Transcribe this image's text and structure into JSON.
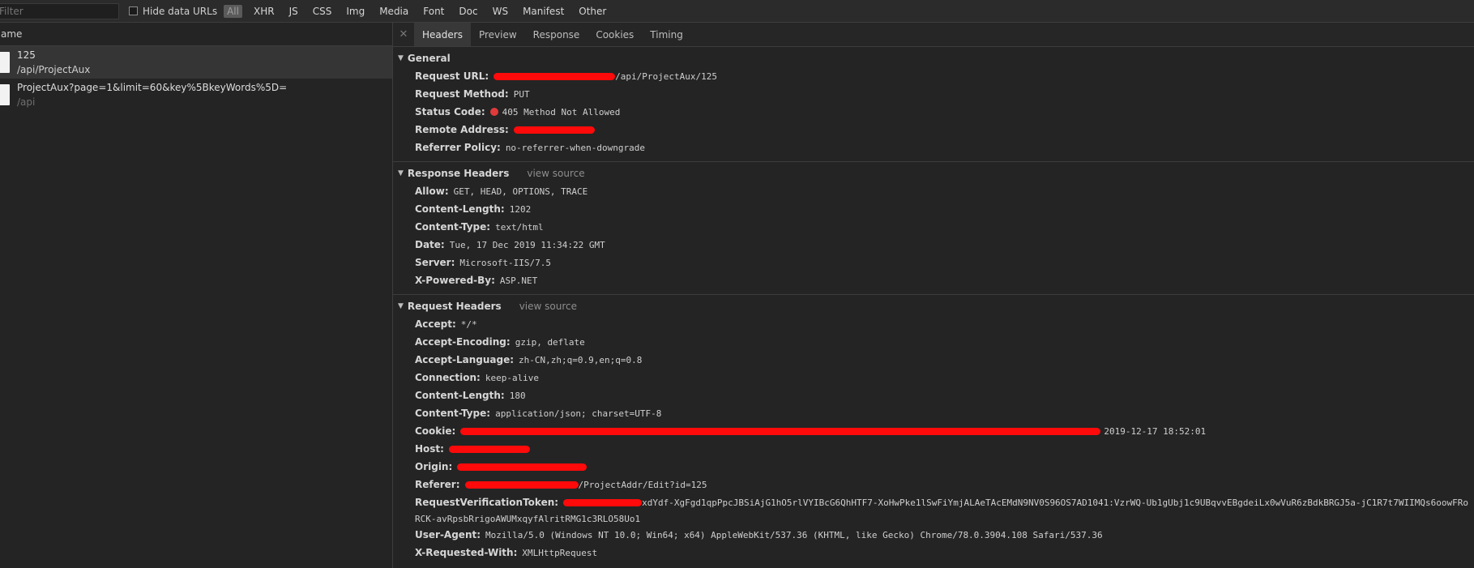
{
  "toolbar": {
    "filter_placeholder": "Filter",
    "hide_data_urls": "Hide data URLs",
    "types": [
      "All",
      "XHR",
      "JS",
      "CSS",
      "Img",
      "Media",
      "Font",
      "Doc",
      "WS",
      "Manifest",
      "Other"
    ],
    "active_type": "All"
  },
  "requests_pane": {
    "header": "Name",
    "requests": [
      {
        "name": "125",
        "path": "/api/ProjectAux",
        "selected": true
      },
      {
        "name": "ProjectAux?page=1&limit=60&key%5BkeyWords%5D=",
        "path": "/api",
        "selected": false
      }
    ]
  },
  "details": {
    "tabs": [
      "Headers",
      "Preview",
      "Response",
      "Cookies",
      "Timing"
    ],
    "active_tab": "Headers",
    "general": {
      "title": "General",
      "rows": {
        "request_url": {
          "key": "Request URL:",
          "value": "/api/ProjectAux/125"
        },
        "request_method": {
          "key": "Request Method:",
          "value": "PUT"
        },
        "status_code": {
          "key": "Status Code:",
          "value": "405 Method Not Allowed"
        },
        "remote_address": {
          "key": "Remote Address:",
          "value": ""
        },
        "referrer_policy": {
          "key": "Referrer Policy:",
          "value": "no-referrer-when-downgrade"
        }
      }
    },
    "response_headers": {
      "title": "Response Headers",
      "view_source": "view source",
      "rows": [
        {
          "key": "Allow:",
          "value": "GET, HEAD, OPTIONS, TRACE"
        },
        {
          "key": "Content-Length:",
          "value": "1202"
        },
        {
          "key": "Content-Type:",
          "value": "text/html"
        },
        {
          "key": "Date:",
          "value": "Tue, 17 Dec 2019 11:34:22 GMT"
        },
        {
          "key": "Server:",
          "value": "Microsoft-IIS/7.5"
        },
        {
          "key": "X-Powered-By:",
          "value": "ASP.NET"
        }
      ]
    },
    "request_headers": {
      "title": "Request Headers",
      "view_source": "view source",
      "rows": [
        {
          "key": "Accept:",
          "value": "*/*"
        },
        {
          "key": "Accept-Encoding:",
          "value": "gzip, deflate"
        },
        {
          "key": "Accept-Language:",
          "value": "zh-CN,zh;q=0.9,en;q=0.8"
        },
        {
          "key": "Connection:",
          "value": "keep-alive"
        },
        {
          "key": "Content-Length:",
          "value": "180"
        },
        {
          "key": "Content-Type:",
          "value": "application/json; charset=UTF-8"
        }
      ],
      "cookie": {
        "key": "Cookie:",
        "value_tail": "2019-12-17 18:52:01"
      },
      "host": {
        "key": "Host:"
      },
      "origin": {
        "key": "Origin:"
      },
      "referer": {
        "key": "Referer:",
        "value_tail": "/ProjectAddr/Edit?id=125"
      },
      "rvt": {
        "key": "RequestVerificationToken:",
        "value_line1": "xdYdf-XgFgd1qpPpcJBSiAjG1hO5rlVYIBcG6QhHTF7-XoHwPke1lSwFiYmjALAeTAcEMdN9NV0S96OS7AD1041:VzrWQ-Ub1gUbj1c9UBqvvEBgdeiLx0wVuR6zBdkBRGJ5a-jC1R7t7WIIMQs6oowFRo",
        "value_line2": "RCK-avRpsbRrigoAWUMxqyfAlritRMG1c3RLO58Uo1"
      },
      "user_agent": {
        "key": "User-Agent:",
        "value": "Mozilla/5.0 (Windows NT 10.0; Win64; x64) AppleWebKit/537.36 (KHTML, like Gecko) Chrome/78.0.3904.108 Safari/537.36"
      },
      "x_requested_with": {
        "key": "X-Requested-With:",
        "value": "XMLHttpRequest"
      }
    }
  }
}
